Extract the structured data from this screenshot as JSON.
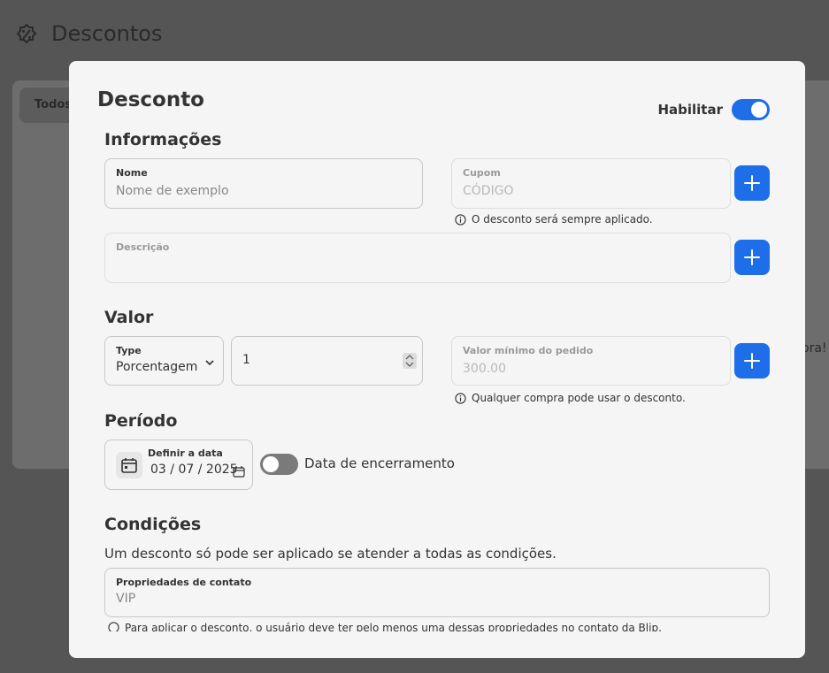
{
  "background": {
    "page_title": "Descontos",
    "tab_label": "Todos",
    "side_text": "ora!"
  },
  "modal": {
    "title": "Desconto",
    "enable_label": "Habilitar",
    "enable_on": true,
    "sections": {
      "info": "Informações",
      "value": "Valor",
      "period": "Período",
      "conditions": "Condições"
    },
    "name": {
      "label": "Nome",
      "placeholder": "Nome de exemplo"
    },
    "coupon": {
      "label": "Cupom",
      "placeholder": "CÓDIGO",
      "hint": "O desconto será sempre aplicado."
    },
    "description": {
      "label": "Descrição",
      "value": ""
    },
    "type": {
      "label": "Type",
      "value": "Porcentagem"
    },
    "amount": {
      "value": "1"
    },
    "min_order": {
      "label": "Valor mínimo do pedido",
      "placeholder": "300.00",
      "hint": "Qualquer compra pode usar o desconto."
    },
    "start_date": {
      "label": "Definir a data",
      "day": "03",
      "month": "07",
      "year": "2025"
    },
    "end_date": {
      "label": "Data de encerramento",
      "enabled": false
    },
    "conditions_desc": "Um desconto só pode ser aplicado se atender a todas as condições.",
    "contact_props": {
      "label": "Propriedades de contato",
      "value": "VIP",
      "hint": "Para aplicar o desconto, o usuário deve ter pelo menos uma dessas propriedades no contato da Blip."
    }
  },
  "colors": {
    "accent": "#1e6eea",
    "overlay": "#555555",
    "modal_bg": "#f5f5f5"
  }
}
